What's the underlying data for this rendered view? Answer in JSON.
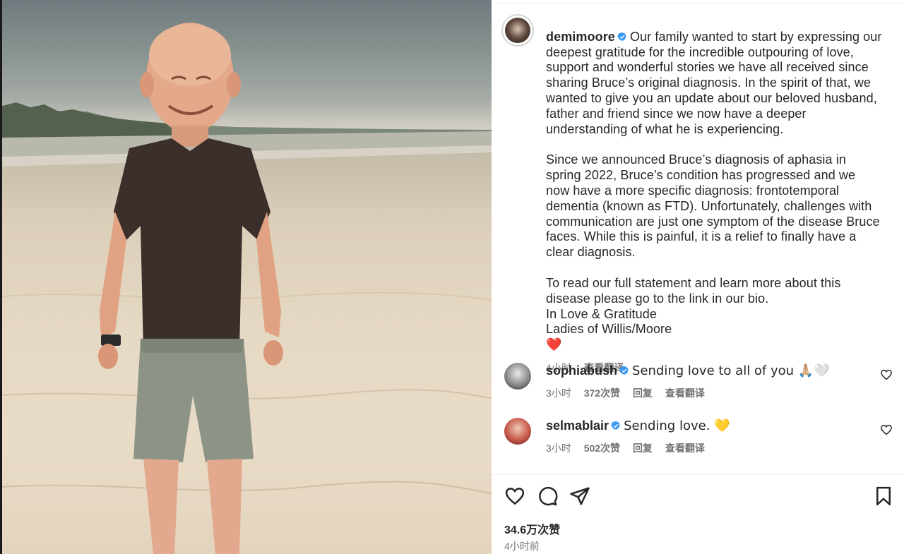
{
  "post": {
    "author": "demimoore",
    "caption_paragraphs": [
      "Our family wanted to start by expressing our deepest gratitude for the incredible outpouring of love, support and wonderful stories we have all received since sharing Bruce’s original diagnosis. In the spirit of that, we wanted to give you an update about our beloved husband, father and friend since we now have a deeper understanding of what he is experiencing.",
      "Since we announced Bruce’s diagnosis of aphasia in spring 2022, Bruce’s condition has progressed and we now have a more specific diagnosis: frontotemporal dementia (known as FTD). Unfortunately, challenges with communication are just one symptom of the disease Bruce faces. While this is painful, it is a relief to finally have a clear diagnosis.",
      "To read our full statement and learn more about this disease please go to the link in our bio.\nIn Love & Gratitude\nLadies of Willis/Moore\n❤️"
    ],
    "caption_time": "4小时",
    "see_translation": "查看翻译",
    "likes": "34.6万次赞",
    "posted_ago": "4小时前"
  },
  "comments": [
    {
      "user": "sophiabush",
      "text": "Sending love to all of you 🙏🏼🤍",
      "time": "3小时",
      "likes": "372次赞",
      "reply": "回复",
      "see_translation": "查看翻译"
    },
    {
      "user": "selmablair",
      "text": "Sending love. 💛",
      "time": "3小时",
      "likes": "502次赞",
      "reply": "回复",
      "see_translation": "查看翻译"
    }
  ],
  "icons": {
    "verified": "verified-badge-icon",
    "like": "heart-icon",
    "comment": "comment-bubble-icon",
    "share": "paper-plane-icon",
    "save": "bookmark-icon"
  },
  "colors": {
    "verified": "#3897f0",
    "text": "#262626",
    "muted": "#737373"
  }
}
